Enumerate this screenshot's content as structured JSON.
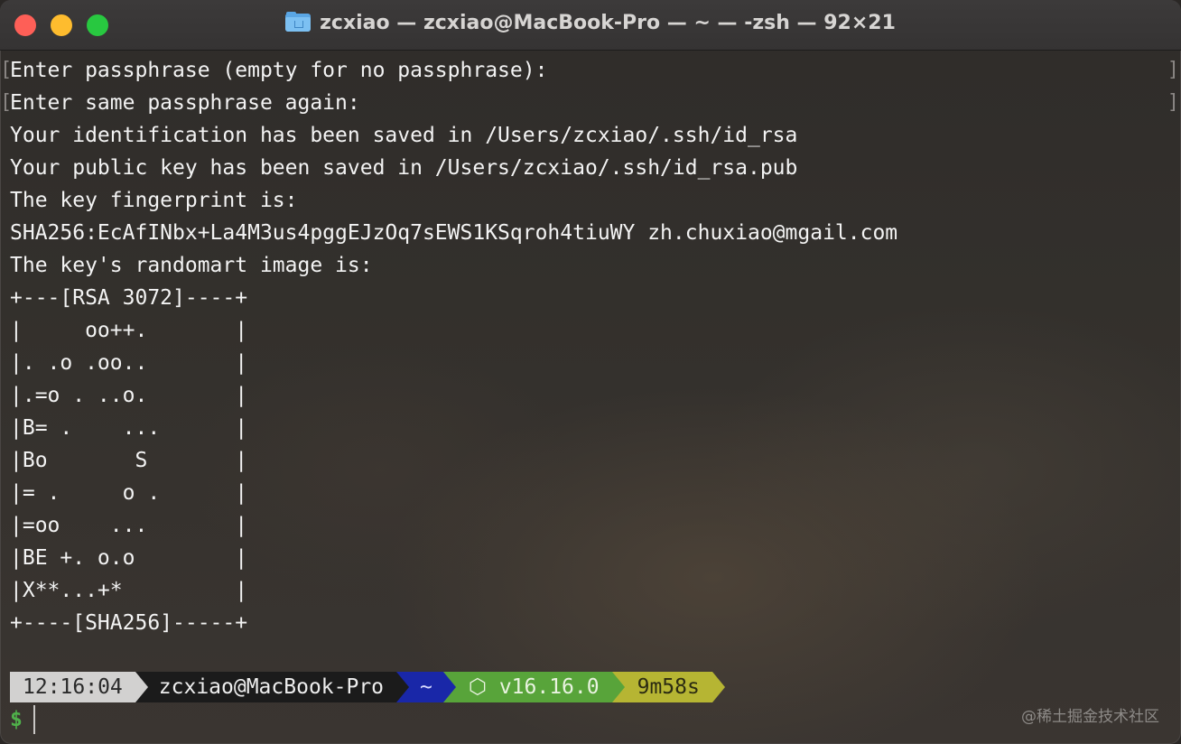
{
  "window": {
    "title": "zcxiao — zcxiao@MacBook-Pro — ~ — -zsh — 92×21",
    "title_icon": "home-folder-icon",
    "controls": [
      "close",
      "minimize",
      "zoom"
    ]
  },
  "terminal": {
    "lines": [
      "Enter passphrase (empty for no passphrase):",
      "Enter same passphrase again:",
      "Your identification has been saved in /Users/zcxiao/.ssh/id_rsa",
      "Your public key has been saved in /Users/zcxiao/.ssh/id_rsa.pub",
      "The key fingerprint is:",
      "SHA256:EcAfINbx+La4M3us4pggEJzOq7sEWS1KSqroh4tiuWY zh.chuxiao@mgail.com",
      "The key's randomart image is:",
      "+---[RSA 3072]----+",
      "|     oo++.       |",
      "|. .o .oo..       |",
      "|.=o . ..o.       |",
      "|B= .    ...      |",
      "|Bo       S       |",
      "|= .     o .      |",
      "|=oo    ...       |",
      "|BE +. o.o        |",
      "|X**...+*         |",
      "+----[SHA256]-----+"
    ]
  },
  "prompt": {
    "time": "12:16:04",
    "host": "zcxiao@MacBook-Pro",
    "dir": "~",
    "node": "⬡ v16.16.0",
    "duration": "9m58s",
    "symbol": "$"
  },
  "watermark": "@稀土掘金技术社区",
  "colors": {
    "accent_blue": "#1927a8",
    "node_green": "#58a43a",
    "duration_yellow": "#b6b533",
    "prompt_green": "#4fb04a"
  }
}
